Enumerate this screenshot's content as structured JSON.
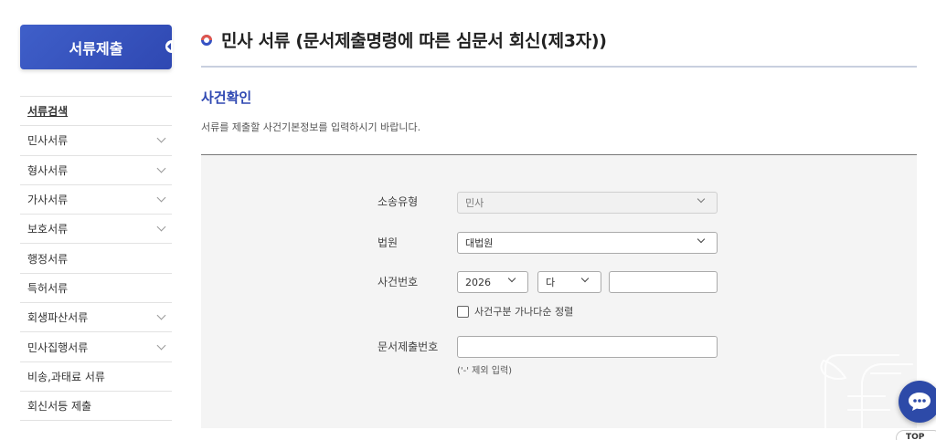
{
  "sidebar": {
    "header": "서류제출",
    "items": [
      {
        "label": "서류검색",
        "expandable": false,
        "active": true
      },
      {
        "label": "민사서류",
        "expandable": true
      },
      {
        "label": "형사서류",
        "expandable": true
      },
      {
        "label": "가사서류",
        "expandable": true
      },
      {
        "label": "보호서류",
        "expandable": true
      },
      {
        "label": "행정서류",
        "expandable": false
      },
      {
        "label": "특허서류",
        "expandable": false
      },
      {
        "label": "회생파산서류",
        "expandable": true
      },
      {
        "label": "민사집행서류",
        "expandable": true
      },
      {
        "label": "비송,과태료 서류",
        "expandable": false
      },
      {
        "label": "회신서등 제출",
        "expandable": false
      }
    ]
  },
  "main": {
    "title": "민사 서류 (문서제출명령에 따른 심문서 회신(제3자))",
    "section_title": "사건확인",
    "section_desc": "서류를 제출할 사건기본정보를 입력하시기 바랍니다."
  },
  "form": {
    "case_type_label": "소송유형",
    "case_type_value": "민사",
    "court_label": "법원",
    "court_value": "대법원",
    "case_number_label": "사건번호",
    "year_value": "2026",
    "case_code_value": "다",
    "case_serial_value": "",
    "sort_checkbox_label": "사건구분 가나다순 정렬",
    "doc_number_label": "문서제출번호",
    "doc_number_value": "",
    "doc_number_hint": "('-' 제외 입력)"
  },
  "floating": {
    "top_label": "TOP"
  },
  "colors": {
    "brand": "#2f48b2",
    "accent_red": "#e0564d"
  }
}
